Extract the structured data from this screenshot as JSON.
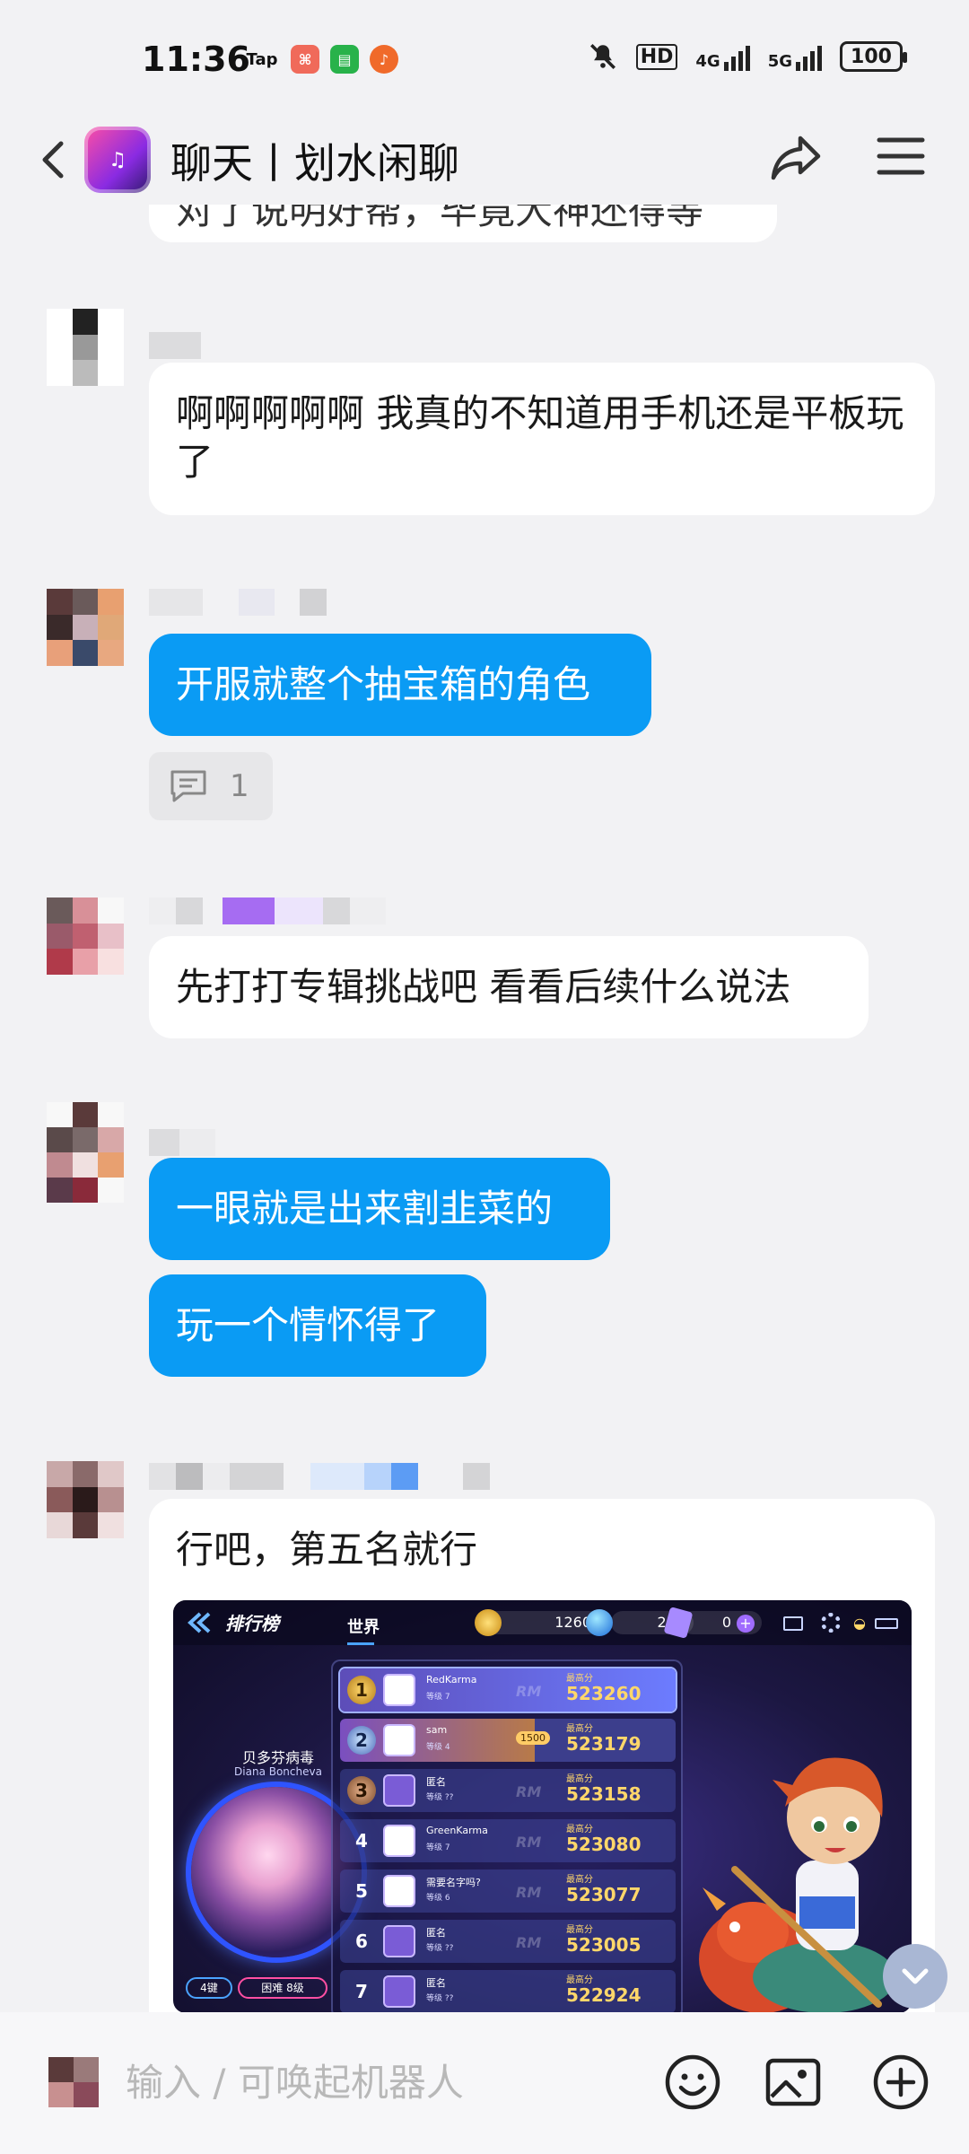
{
  "status": {
    "time": "11:36",
    "app_icons": [
      "Tap",
      "game",
      "chat",
      "music"
    ],
    "battery": "100",
    "network": [
      "HD",
      "4G",
      "5G"
    ]
  },
  "header": {
    "title": "聊天丨划水闲聊",
    "avatar_icon": "group-avatar"
  },
  "messages": [
    {
      "text": "对了说明好帮，毕竟大神还得等",
      "kind": "incoming-clipped"
    },
    {
      "text": "啊啊啊啊啊 我真的不知道用手机还是平板玩了",
      "kind": "white"
    },
    {
      "text": "开服就整个抽宝箱的角色",
      "kind": "blue"
    },
    {
      "reply_count": "1"
    },
    {
      "text": "先打打专辑挑战吧 看看后续什么说法",
      "kind": "white"
    },
    {
      "text": "一眼就是出来割韭菜的",
      "kind": "blue"
    },
    {
      "text": "玩一个情怀得了",
      "kind": "blue"
    },
    {
      "text": "行吧，第五名就行",
      "kind": "white"
    }
  ],
  "leaderboard_image": {
    "title": "排行榜",
    "tab": "世界",
    "currency1": "1260",
    "currency2": "210",
    "currency3": "0",
    "song_name": "贝多芬病毒",
    "song_artist": "Diana Boncheva",
    "key_mode": "4键",
    "difficulty": "困难  8级",
    "high_score_label": "最高分",
    "level_label": "等级",
    "watermark": "RM",
    "rows": [
      {
        "rank": "1",
        "name": "RedKarma",
        "level": "7",
        "score": "523260"
      },
      {
        "rank": "2",
        "name": "sam",
        "level": "4",
        "score": "523179",
        "tag": "1500"
      },
      {
        "rank": "3",
        "name": "匿名",
        "level": "??",
        "score": "523158"
      },
      {
        "rank": "4",
        "name": "GreenKarma",
        "level": "7",
        "score": "523080"
      },
      {
        "rank": "5",
        "name": "需要名字吗?",
        "level": "6",
        "score": "523077"
      },
      {
        "rank": "6",
        "name": "匿名",
        "level": "??",
        "score": "523005"
      },
      {
        "rank": "7",
        "name": "匿名",
        "level": "??",
        "score": "522924"
      }
    ]
  },
  "input": {
    "placeholder": "输入 / 可唤起机器人"
  },
  "icons": {
    "back": "back-icon",
    "share": "share-icon",
    "menu": "menu-icon",
    "emoji": "emoji-icon",
    "image": "image-icon",
    "plus": "plus-icon",
    "scroll_down": "chevron-down-icon"
  },
  "colors": {
    "blue_bubble": "#0a9bf4",
    "background": "#f2f2f4"
  }
}
